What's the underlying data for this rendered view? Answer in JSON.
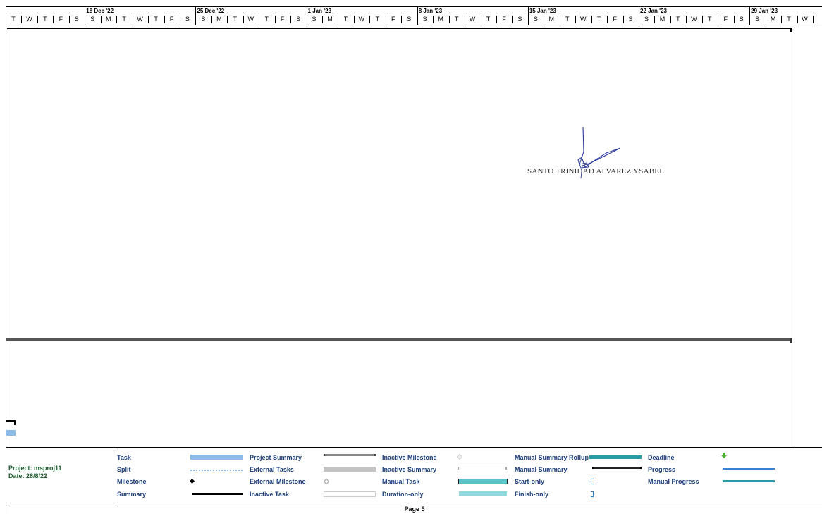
{
  "timescale": {
    "weeks": [
      "18 Dec '22",
      "25 Dec '22",
      "1 Jan '23",
      "8 Jan '23",
      "15 Jan '23",
      "22 Jan '23",
      "29 Jan '23"
    ],
    "days": [
      "T",
      "W",
      "T",
      "F",
      "S",
      "S",
      "M",
      "T",
      "W",
      "T",
      "F",
      "S",
      "S",
      "M",
      "T",
      "W",
      "T",
      "F",
      "S",
      "S",
      "M",
      "T",
      "W",
      "T",
      "F",
      "S",
      "S",
      "M",
      "T",
      "W",
      "T",
      "F",
      "S",
      "S",
      "M",
      "T",
      "W",
      "T",
      "F",
      "S",
      "S",
      "M",
      "T",
      "W",
      "T",
      "F",
      "S",
      "S",
      "M",
      "T",
      "W",
      "T"
    ]
  },
  "signature": {
    "name": "SANTO TRINIDAD ALVAREZ YSABEL"
  },
  "legend": {
    "project": "Project: msproj11",
    "date": "Date: 28/8/22",
    "items": [
      {
        "label": "Task",
        "symbol": "task-bar-icon"
      },
      {
        "label": "Split",
        "symbol": "split-icon"
      },
      {
        "label": "Milestone",
        "symbol": "milestone-icon"
      },
      {
        "label": "Summary",
        "symbol": "summary-bar-icon"
      },
      {
        "label": "Project Summary",
        "symbol": "project-summary-icon"
      },
      {
        "label": "External Tasks",
        "symbol": "external-tasks-icon"
      },
      {
        "label": "External Milestone",
        "symbol": "external-milestone-icon"
      },
      {
        "label": "Inactive Task",
        "symbol": "inactive-task-icon"
      },
      {
        "label": "Inactive Milestone",
        "symbol": "inactive-milestone-icon"
      },
      {
        "label": "Inactive Summary",
        "symbol": "inactive-summary-icon"
      },
      {
        "label": "Manual Task",
        "symbol": "manual-task-icon"
      },
      {
        "label": "Duration-only",
        "symbol": "duration-only-icon"
      },
      {
        "label": "Manual Summary Rollup",
        "symbol": "manual-summary-rollup-icon"
      },
      {
        "label": "Manual Summary",
        "symbol": "manual-summary-icon"
      },
      {
        "label": "Start-only",
        "symbol": "start-only-icon"
      },
      {
        "label": "Finish-only",
        "symbol": "finish-only-icon"
      },
      {
        "label": "Deadline",
        "symbol": "deadline-icon"
      },
      {
        "label": "Progress",
        "symbol": "progress-icon"
      },
      {
        "label": "Manual Progress",
        "symbol": "manual-progress-icon"
      }
    ]
  },
  "footer": {
    "page": "Page 5"
  },
  "colors": {
    "task": "#8cbbe8",
    "manual": "#5cc3c9",
    "rollup": "#2a9aa6",
    "progress": "#3a82d6",
    "deadline": "#4caf2a",
    "legend_text": "#1a3d7a"
  }
}
